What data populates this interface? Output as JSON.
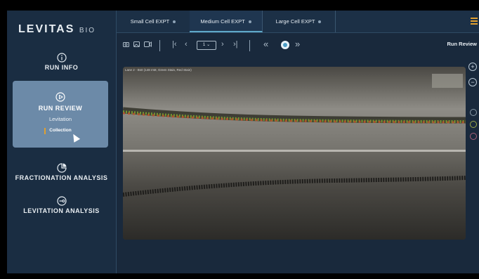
{
  "brand": {
    "name": "LEVITAS",
    "suffix": "BIO"
  },
  "sidebar": {
    "run_info": "RUN INFO",
    "run_review": "RUN REVIEW",
    "review_sub1": "Levitation",
    "review_sub2": "Collection",
    "fractionation": "FRACTIONATION ANALYSIS",
    "levitation": "LEVITATION ANALYSIS"
  },
  "tabs": [
    {
      "label": "Small Cell EXPT",
      "active": false
    },
    {
      "label": "Medium Cell EXPT",
      "active": true
    },
    {
      "label": "Large Cell EXPT",
      "active": false
    }
  ],
  "toolbar": {
    "page_value": "1"
  },
  "section_title": "Run Review",
  "viewer": {
    "lane_label": "Lane 2 - Bs0 (148 mM, Green Stain, Red Stain)"
  },
  "colors": {
    "accent": "#e0a030",
    "active_tab_border": "#5fa9c8",
    "sidebar_card": "#6c8aa8"
  }
}
